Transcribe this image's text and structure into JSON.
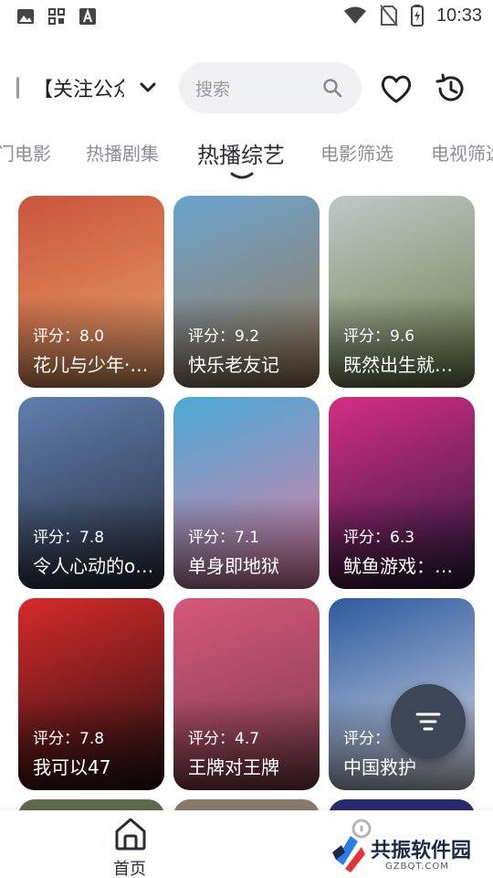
{
  "status_bar": {
    "time": "10:33",
    "left_icons": [
      "image-icon",
      "grid-apps-icon",
      "font-a-icon"
    ],
    "right_icons": [
      "wifi-icon",
      "no-sim-icon",
      "battery-charging-icon"
    ]
  },
  "header": {
    "channel_label": "【关注公众号",
    "search_placeholder": "搜索"
  },
  "tabs": [
    {
      "label": "门电影",
      "active": false
    },
    {
      "label": "热播剧集",
      "active": false
    },
    {
      "label": "热播综艺",
      "active": true
    },
    {
      "label": "电影筛选",
      "active": false
    },
    {
      "label": "电视筛选",
      "active": false
    }
  ],
  "grid": {
    "items": [
      {
        "rating": "评分：8.0",
        "title": "花儿与少年·丝路季",
        "colors": [
          "#c9553c",
          "#e8a06a"
        ]
      },
      {
        "rating": "评分：9.2",
        "title": "快乐老友记",
        "colors": [
          "#6aa3cf",
          "#9b7a55"
        ]
      },
      {
        "rating": "评分：9.6",
        "title": "既然出生就环游世界",
        "colors": [
          "#bfc8c8",
          "#6d7d4c"
        ]
      },
      {
        "rating": "评分：7.8",
        "title": "令人心动的offer",
        "colors": [
          "#5f7fae",
          "#2a2c3c"
        ]
      },
      {
        "rating": "评分：7.1",
        "title": "单身即地狱",
        "colors": [
          "#4aa9d6",
          "#e27ea4"
        ]
      },
      {
        "rating": "评分：6.3",
        "title": "鱿鱼游戏：挑战",
        "colors": [
          "#d42d86",
          "#2b1a3c"
        ]
      },
      {
        "rating": "评分：7.8",
        "title": "我可以47",
        "colors": [
          "#d62a2a",
          "#241012"
        ]
      },
      {
        "rating": "评分：4.7",
        "title": "王牌对王牌",
        "colors": [
          "#d6587a",
          "#7a3b4e"
        ]
      },
      {
        "rating": "评分：",
        "title": "中国救护",
        "colors": [
          "#2d5a9e",
          "#d9dde8"
        ]
      }
    ],
    "partial_row_colors": [
      "#5e6b4a",
      "#8a7a6a",
      "#2b2a6e"
    ]
  },
  "bottom_nav": {
    "home_label": "首页"
  },
  "watermark": {
    "name": "共振软件园",
    "domain": "GZBQT.COM"
  },
  "colors": {
    "accent": "#3c4656",
    "tab_inactive": "#8a8f98",
    "tab_active": "#2a2e36"
  }
}
